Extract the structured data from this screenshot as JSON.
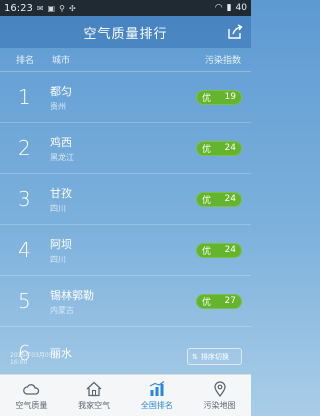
{
  "status": {
    "time": "16:23",
    "battery": "40"
  },
  "header": {
    "title": "空气质量排行"
  },
  "columns": {
    "rank": "排名",
    "city": "城市",
    "index": "污染指数"
  },
  "rows": [
    {
      "rank": "1",
      "city": "都匀",
      "province": "贵州",
      "level": "优",
      "value": "19"
    },
    {
      "rank": "2",
      "city": "鸡西",
      "province": "黑龙江",
      "level": "优",
      "value": "24"
    },
    {
      "rank": "3",
      "city": "甘孜",
      "province": "四川",
      "level": "优",
      "value": "24"
    },
    {
      "rank": "4",
      "city": "阿坝",
      "province": "四川",
      "level": "优",
      "value": "24"
    },
    {
      "rank": "5",
      "city": "锡林郭勒",
      "province": "内蒙古",
      "level": "优",
      "value": "27"
    },
    {
      "rank": "6",
      "city": "丽水",
      "province": "",
      "level": "",
      "value": ""
    }
  ],
  "footer": {
    "date": "2015年03月05日",
    "time": "16:00",
    "sort_label": "排序切换"
  },
  "tabs": [
    {
      "label": "空气质量",
      "icon": "cloud-icon"
    },
    {
      "label": "我家空气",
      "icon": "home-icon"
    },
    {
      "label": "全国排名",
      "icon": "bar-chart-icon"
    },
    {
      "label": "污染地图",
      "icon": "map-pin-icon"
    }
  ],
  "colors": {
    "badge_good": "#64b52d",
    "active_tab": "#2a86d8"
  }
}
